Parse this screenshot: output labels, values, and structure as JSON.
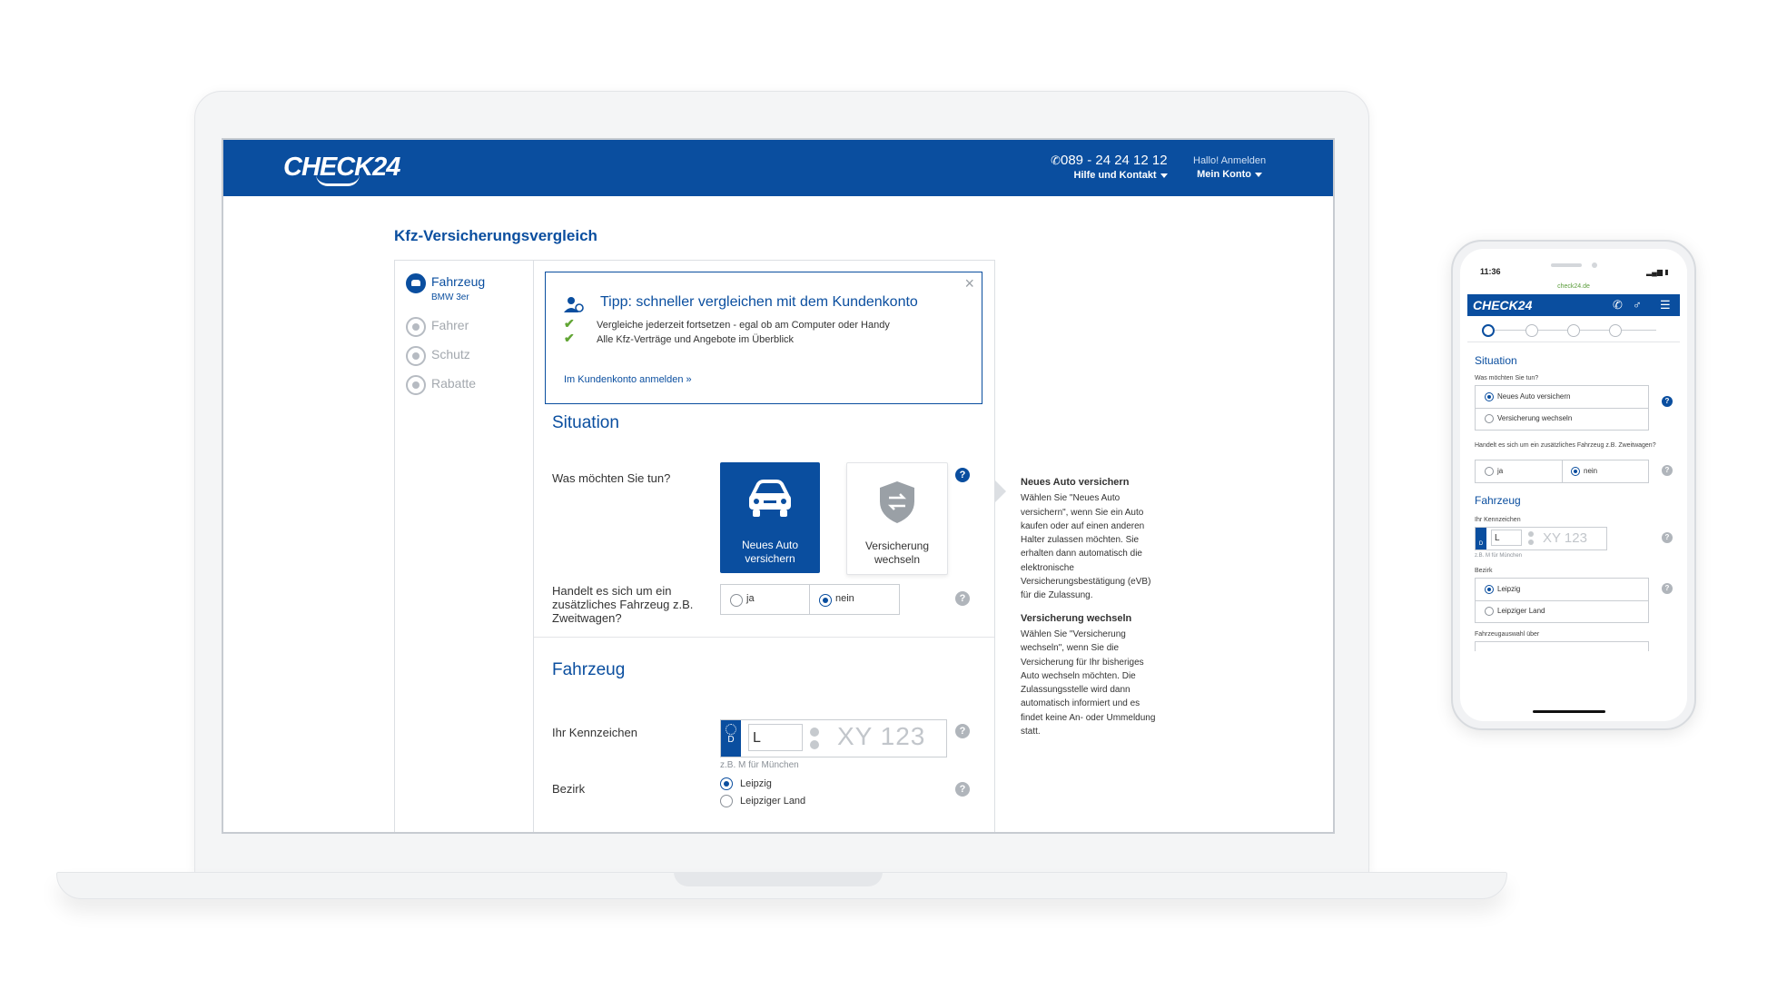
{
  "desktop": {
    "header": {
      "logo": "CHECK24",
      "phone": "089 - 24 24 12 12",
      "help_link": "Hilfe und Kontakt",
      "account_greeting": "Hallo! Anmelden",
      "account_link": "Mein Konto"
    },
    "page_title": "Kfz-Versicherungsvergleich",
    "steps": [
      {
        "label": "Fahrzeug",
        "sub": "BMW 3er"
      },
      {
        "label": "Fahrer"
      },
      {
        "label": "Schutz"
      },
      {
        "label": "Rabatte"
      }
    ],
    "tip": {
      "title": "Tipp: schneller vergleichen mit dem Kundenkonto",
      "items": [
        "Vergleiche jederzeit fortsetzen - egal ob am Computer oder Handy",
        "Alle Kfz-Verträge und Angebote im Überblick"
      ],
      "link": "Im Kundenkonto anmelden »",
      "close": "×"
    },
    "situation": {
      "title": "Situation",
      "question": "Was möchten Sie tun?",
      "option_new": "Neues Auto versichern",
      "option_switch": "Versicherung wechseln",
      "second_question": "Handelt es sich um ein zusätzliches Fahrzeug z.B. Zweitwagen?",
      "yes": "ja",
      "no": "nein"
    },
    "fahrzeug": {
      "title": "Fahrzeug",
      "plate_label": "Ihr Kennzeichen",
      "plate_country": "D",
      "plate_prefix": "L",
      "plate_placeholder": "XY 123",
      "plate_hint": "z.B. M für München",
      "district_label": "Bezirk",
      "district_options": [
        "Leipzig",
        "Leipziger Land"
      ]
    },
    "info": {
      "title1": "Neues Auto versichern",
      "body1": "Wählen Sie \"Neues Auto versichern\", wenn Sie ein Auto kaufen oder auf einen anderen Halter zulassen möchten. Sie erhalten dann automatisch die elektronische Versicherungsbestätigung (eVB) für die Zulassung.",
      "title2": "Versicherung wechseln",
      "body2": "Wählen Sie \"Versicherung wechseln\", wenn Sie die Versicherung für Ihr bisheriges Auto wechseln möchten. Die Zulassungsstelle wird dann automatisch informiert und es findet keine An- oder Ummeldung statt."
    },
    "help": "?"
  },
  "mobile": {
    "time": "11:36",
    "url": "check24.de",
    "logo": "CHECK24",
    "situation_title": "Situation",
    "question": "Was möchten Sie tun?",
    "option_new": "Neues Auto versichern",
    "option_switch": "Versicherung wechseln",
    "second_question": "Handelt es sich um ein zusätzliches Fahrzeug z.B. Zweitwagen?",
    "yes": "ja",
    "no": "nein",
    "fahrzeug_title": "Fahrzeug",
    "plate_label": "Ihr Kennzeichen",
    "plate_country": "D",
    "plate_prefix": "L",
    "plate_placeholder": "XY 123",
    "plate_hint": "z.B. M für München",
    "district_label": "Bezirk",
    "district_options": [
      "Leipzig",
      "Leipziger Land"
    ],
    "vehicle_select_label": "Fahrzeugauswahl über"
  },
  "colors": {
    "brand": "#0a4e9f",
    "check": "#61a534"
  },
  "icons": [
    "phone-icon",
    "user-icon",
    "menu-icon",
    "car-icon",
    "shield-swap-icon",
    "help-icon",
    "close-icon",
    "check-icon"
  ]
}
